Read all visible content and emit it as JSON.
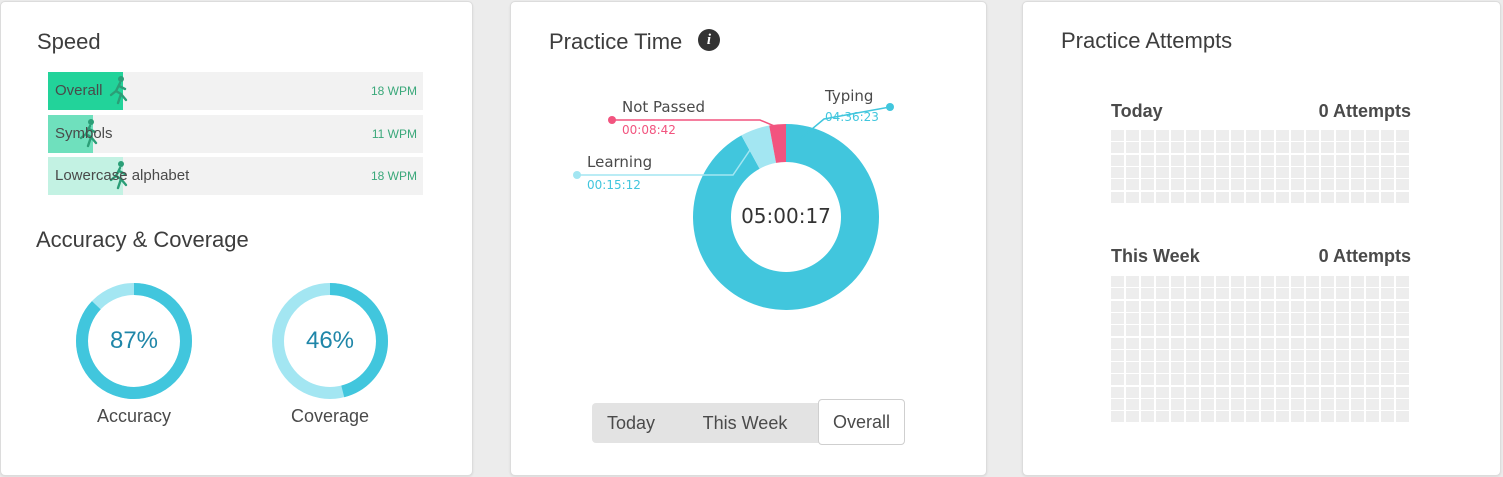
{
  "speed": {
    "title": "Speed",
    "rows": [
      {
        "label": "Overall",
        "value": "18 WPM",
        "fill_fraction": 0.2,
        "color": "#22d39a"
      },
      {
        "label": "Symbols",
        "value": "11 WPM",
        "fill_fraction": 0.12,
        "color": "#6fe0bd"
      },
      {
        "label": "Lowercase alphabet",
        "value": "18 WPM",
        "fill_fraction": 0.2,
        "color": "#c3f2e3"
      }
    ]
  },
  "accuracy": {
    "title": "Accuracy & Coverage",
    "items": [
      {
        "value": "87%",
        "caption": "Accuracy",
        "fraction": 0.87
      },
      {
        "value": "46%",
        "caption": "Coverage",
        "fraction": 0.46
      }
    ]
  },
  "practice_time": {
    "title": "Practice Time",
    "info_icon": "info-icon",
    "total": "05:00:17",
    "segments": [
      {
        "name": "Typing",
        "time": "04:36:23",
        "seconds": 16583,
        "color": "#41c6dd"
      },
      {
        "name": "Learning",
        "time": "00:15:12",
        "seconds": 912,
        "color": "#a3e6f2"
      },
      {
        "name": "Not Passed",
        "time": "00:08:42",
        "seconds": 522,
        "color": "#f2547f"
      }
    ],
    "tabs": [
      "Today",
      "This Week",
      "Overall"
    ],
    "active_tab": "Overall"
  },
  "attempts": {
    "title": "Practice Attempts",
    "today": {
      "label": "Today",
      "value": "0 Attempts"
    },
    "week": {
      "label": "This Week",
      "value": "0 Attempts"
    }
  }
}
